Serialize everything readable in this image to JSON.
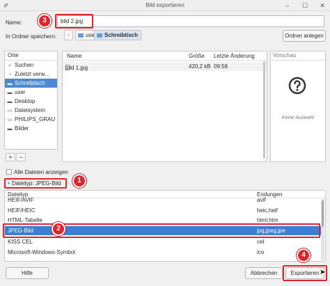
{
  "window": {
    "title": "Bild exportieren",
    "minimize": "–",
    "maximize": "☐",
    "close": "✕",
    "app_icon": "gimp-icon"
  },
  "name": {
    "label": "Name:",
    "value": "bild 2.jpg"
  },
  "folder": {
    "label": "In Ordner speichern:",
    "back": "‹",
    "crumbs": [
      "user",
      "Schreibtisch"
    ],
    "create_folder": "Ordner anlegen"
  },
  "places": {
    "header": "Orte",
    "items": [
      {
        "label": "Suchen",
        "icon": "search-icon"
      },
      {
        "label": "Zuletzt verw...",
        "icon": "recent-icon"
      },
      {
        "label": "Schreibtisch",
        "icon": "folder-icon"
      },
      {
        "label": "user",
        "icon": "home-icon"
      },
      {
        "label": "Desktop",
        "icon": "folder-icon"
      },
      {
        "label": "Dateisystem",
        "icon": "drive-icon"
      },
      {
        "label": "PHILIPS_GRAU",
        "icon": "usb-drive-icon"
      },
      {
        "label": "Bilder",
        "icon": "folder-icon"
      }
    ],
    "add": "+",
    "remove": "−"
  },
  "files": {
    "headers": {
      "name": "Name",
      "size": "Größe",
      "modified": "Letzte Änderung"
    },
    "rows": [
      {
        "name": "bild 1.jpg",
        "size": "420,2 kB",
        "modified": "09:58"
      }
    ]
  },
  "preview": {
    "header": "Vorschau",
    "empty": "Keine Auswahl"
  },
  "all_files": {
    "label": "Alle Dateien anzeigen"
  },
  "filetype": {
    "label": "Dateityp: JPEG-Bild"
  },
  "types": {
    "headers": {
      "type": "Dateityp",
      "extensions": "Endungen"
    },
    "rows": [
      {
        "type": "HEIF/AVIF",
        "ext": "avif"
      },
      {
        "type": "HEIF/HEIC",
        "ext": "heic,heif"
      },
      {
        "type": "HTML-Tabelle",
        "ext": "html,htm"
      },
      {
        "type": "JPEG-Bild",
        "ext": "jpg,jpeg,jpe",
        "selected": true
      },
      {
        "type": "KISS CEL",
        "ext": "cel"
      },
      {
        "type": "Microsoft-Windows-Symbol",
        "ext": "ico"
      }
    ]
  },
  "buttons": {
    "help": "Hilfe",
    "cancel": "Abbrechen",
    "export": "Exportieren"
  },
  "markers": [
    "1",
    "2",
    "3",
    "4"
  ],
  "colors": {
    "highlight": "#e0242c",
    "selection": "#3a7fd4",
    "places_selection": "#4a8bd4"
  }
}
